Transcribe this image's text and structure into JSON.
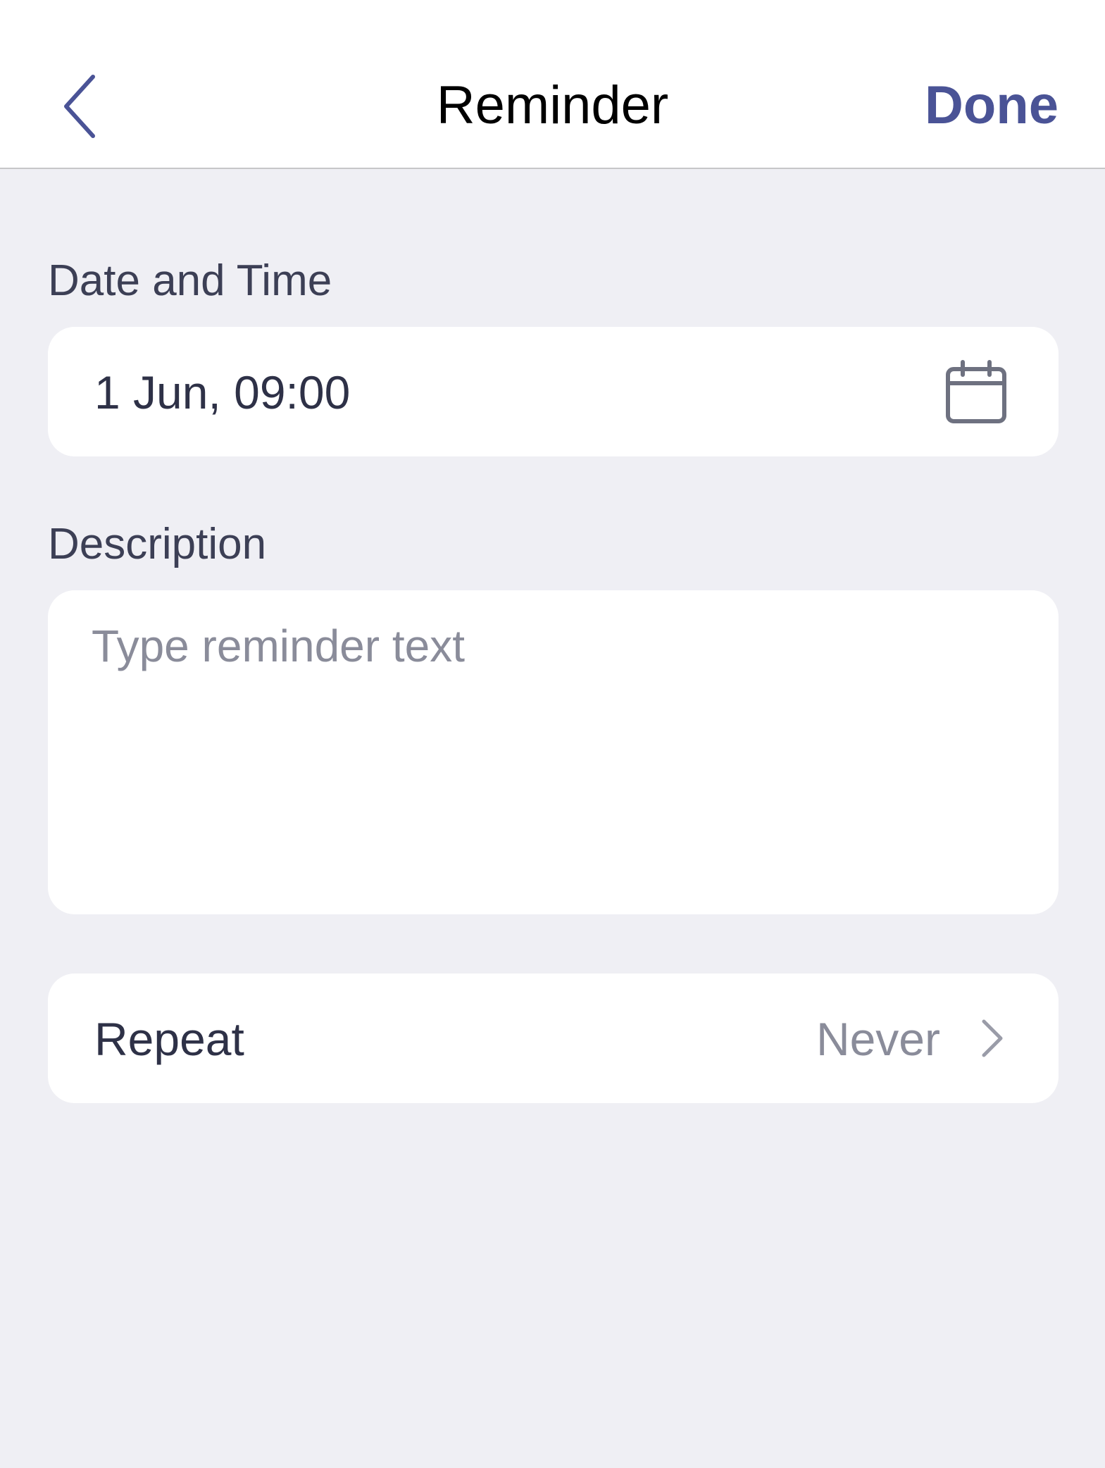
{
  "navbar": {
    "back_icon": "chevron-left-icon",
    "title": "Reminder",
    "done_label": "Done"
  },
  "date_time": {
    "label": "Date and Time",
    "value": "1 Jun, 09:00",
    "icon": "calendar-icon"
  },
  "description": {
    "label": "Description",
    "placeholder": "Type reminder text",
    "value": ""
  },
  "repeat": {
    "label": "Repeat",
    "value": "Never",
    "icon": "chevron-right-icon"
  },
  "colors": {
    "accent": "#4A5396",
    "background": "#EFEFF4",
    "card": "#FFFFFF",
    "text_primary": "#2E3147",
    "text_secondary": "#8A8C9A"
  }
}
